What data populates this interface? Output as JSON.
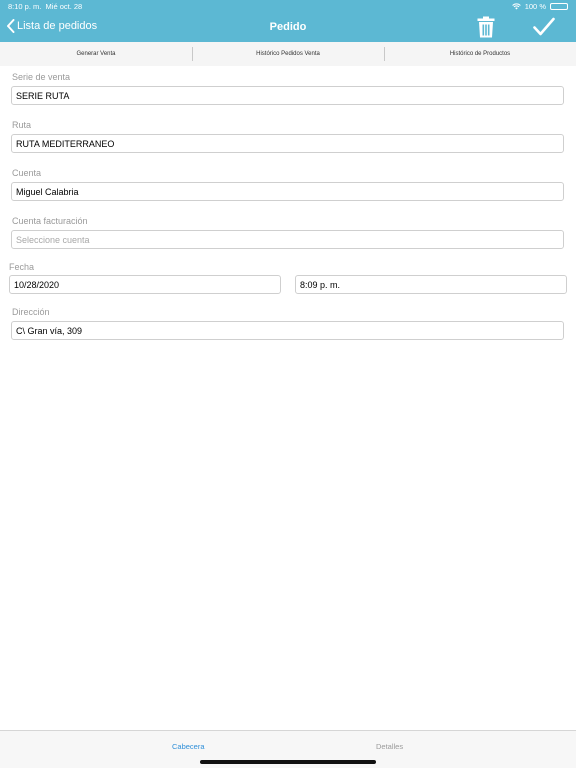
{
  "status_bar": {
    "time": "8:10 p. m.",
    "date": "Mié oct. 28",
    "battery": "100 %",
    "battery_level": 1.0
  },
  "header": {
    "back_label": "Lista de pedidos",
    "title": "Pedido",
    "background_color": "#5cb8d3",
    "icons": [
      "chevron-left-icon",
      "trash-icon",
      "checkmark-icon"
    ]
  },
  "segments": [
    {
      "label": "Generar Venta"
    },
    {
      "label": "Histórico Pedidos Venta"
    },
    {
      "label": "Histórico de Productos"
    }
  ],
  "form": {
    "serie": {
      "label": "Serie de venta",
      "value": "SERIE RUTA"
    },
    "ruta": {
      "label": "Ruta",
      "value": "RUTA MEDITERRANEO"
    },
    "cuenta": {
      "label": "Cuenta",
      "value": "Miguel Calabria"
    },
    "cuenta_facturacion": {
      "label": "Cuenta facturación",
      "value": "",
      "placeholder": "Seleccione cuenta"
    },
    "fecha": {
      "label": "Fecha",
      "date_value": "10/28/2020",
      "time_value": "8:09 p. m."
    },
    "direccion": {
      "label": "Dirección",
      "value": "C\\ Gran vía, 309"
    }
  },
  "tabs": [
    {
      "label": "Cabecera",
      "active": true,
      "color": "#2f8fd8"
    },
    {
      "label": "Detalles",
      "active": false,
      "color": "#9a9a9a"
    }
  ]
}
